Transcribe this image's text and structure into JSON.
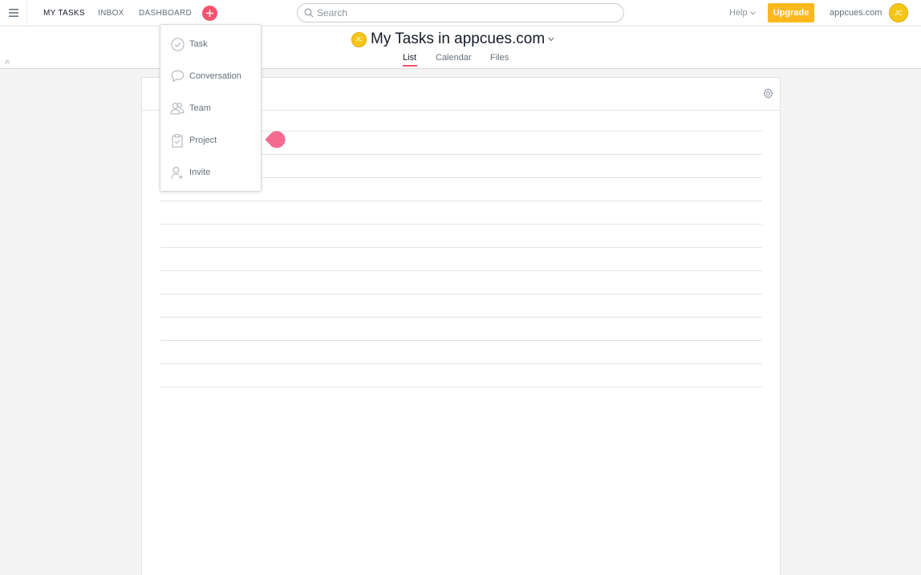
{
  "nav": {
    "items": [
      {
        "label": "MY TASKS"
      },
      {
        "label": "INBOX"
      },
      {
        "label": "DASHBOARD"
      }
    ]
  },
  "search": {
    "placeholder": "Search"
  },
  "help": {
    "label": "Help"
  },
  "upgrade": {
    "label": "Upgrade"
  },
  "workspace": {
    "name": "appcues.com"
  },
  "user": {
    "initials": "JC"
  },
  "header": {
    "title": "My Tasks in appcues.com",
    "tabs": [
      {
        "label": "List",
        "active": true
      },
      {
        "label": "Calendar"
      },
      {
        "label": "Files"
      }
    ]
  },
  "add_menu": {
    "items": [
      {
        "label": "Task",
        "icon": "check-circle-icon"
      },
      {
        "label": "Conversation",
        "icon": "speech-bubble-icon"
      },
      {
        "label": "Team",
        "icon": "team-icon"
      },
      {
        "label": "Project",
        "icon": "clipboard-icon"
      },
      {
        "label": "Invite",
        "icon": "invite-user-icon"
      }
    ]
  },
  "colors": {
    "accent": "#f4536d",
    "upgrade": "#fdb81e",
    "avatar": "#f5c518"
  }
}
